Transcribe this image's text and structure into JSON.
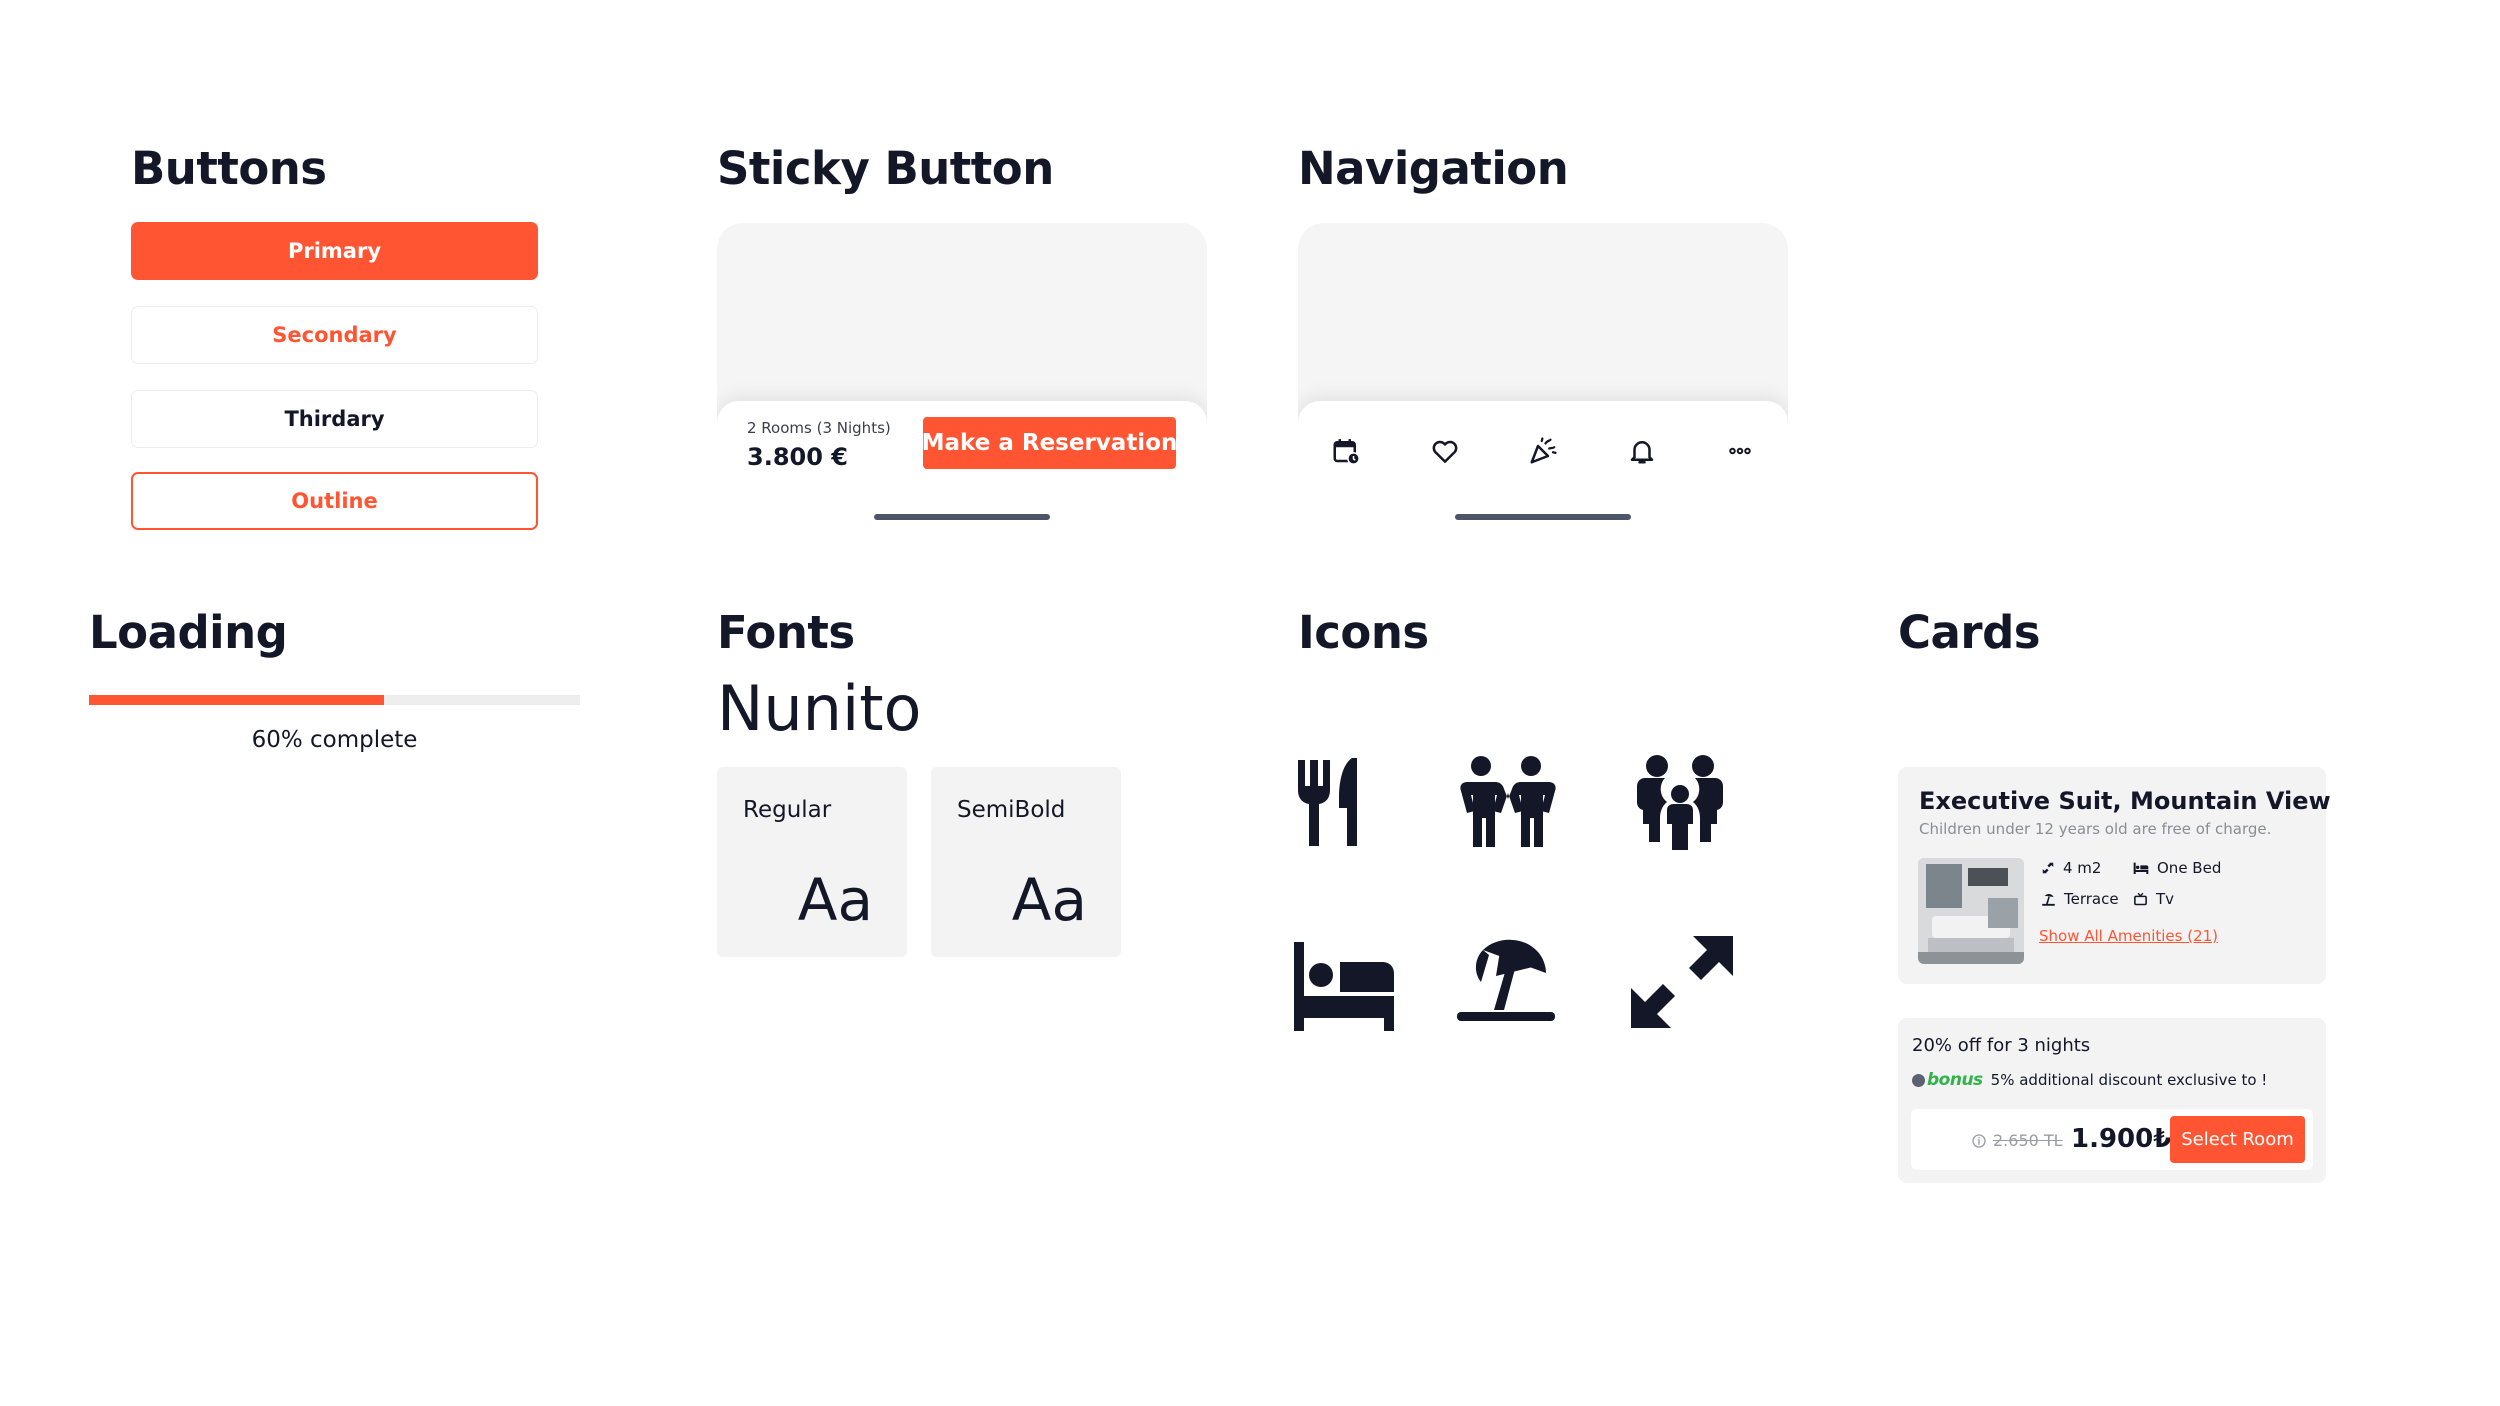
{
  "colors": {
    "accent": "#FF5533",
    "ink": "#131728",
    "surface": "#F3F3F3"
  },
  "sections": {
    "buttons": "Buttons",
    "sticky": "Sticky Button",
    "navigation": "Navigation",
    "loading": "Loading",
    "fonts": "Fonts",
    "icons": "Icons",
    "cards": "Cards"
  },
  "buttons": {
    "primary": "Primary",
    "secondary": "Secondary",
    "thirdary": "Thirdary",
    "outline": "Outline"
  },
  "sticky": {
    "rooms": "2 Rooms (3 Nights)",
    "price": "3.800 €",
    "cta": "Make a Reservation"
  },
  "navigation": {
    "items": [
      "calendar-clock-icon",
      "heart-icon",
      "party-popper-icon",
      "bell-icon",
      "more-dots-icon"
    ]
  },
  "loading": {
    "progress": 0.6,
    "label": "60% complete"
  },
  "fonts": {
    "family": "Nunito",
    "weights": [
      {
        "label": "Regular",
        "sample": "Aa"
      },
      {
        "label": "SemiBold",
        "sample": "Aa"
      }
    ]
  },
  "icons": [
    "fork-knife-icon",
    "couple-icon",
    "family-icon",
    "bed-icon",
    "beach-umbrella-icon",
    "expand-arrows-icon"
  ],
  "room_card": {
    "title": "Executive Suit, Mountain View",
    "subtitle": "Children under 12 years old are free of charge.",
    "amenities": [
      {
        "icon": "size-icon",
        "label": "4 m2"
      },
      {
        "icon": "bed-small-icon",
        "label": "One Bed"
      },
      {
        "icon": "terrace-icon",
        "label": "Terrace"
      },
      {
        "icon": "tv-icon",
        "label": "Tv"
      }
    ],
    "link": "Show All Amenities (21)"
  },
  "deal_card": {
    "title": "20% off for 3 nights",
    "bonus_brand": "bonus",
    "bonus_text": "5% additional discount exclusive to !",
    "old_price": "2.650 TL",
    "new_price": "1.900₺",
    "cta": "Select Room"
  }
}
